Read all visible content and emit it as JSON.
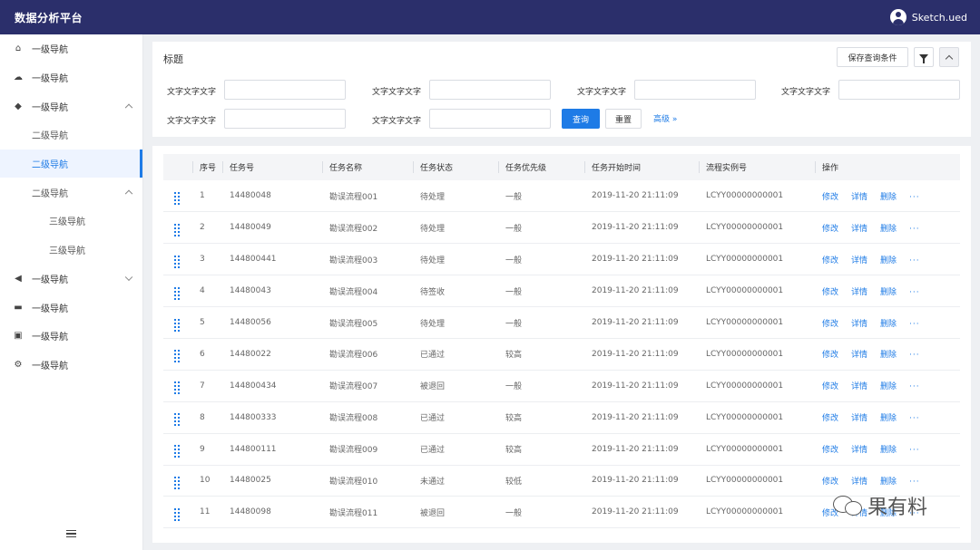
{
  "app": {
    "title": "数据分析平台",
    "user_name": "Sketch.ued"
  },
  "sidebar": {
    "items": [
      {
        "label": "一级导航",
        "icon": "home-icon",
        "level": 1
      },
      {
        "label": "一级导航",
        "icon": "cloud-icon",
        "level": 1
      },
      {
        "label": "一级导航",
        "icon": "tag-icon",
        "level": 1,
        "expanded": true
      },
      {
        "label": "二级导航",
        "level": 2
      },
      {
        "label": "二级导航",
        "level": 2,
        "active": true
      },
      {
        "label": "二级导航",
        "level": 2,
        "expanded": true
      },
      {
        "label": "三级导航",
        "level": 3
      },
      {
        "label": "三级导航",
        "level": 3
      },
      {
        "label": "一级导航",
        "icon": "speaker-icon",
        "level": 1,
        "expanded": false
      },
      {
        "label": "一级导航",
        "icon": "card-icon",
        "level": 1
      },
      {
        "label": "一级导航",
        "icon": "image-icon",
        "level": 1
      },
      {
        "label": "一级导航",
        "icon": "settings-icon",
        "level": 1
      }
    ]
  },
  "filter": {
    "title": "标题",
    "save_label": "保存查询条件",
    "field_label": "文字文字文字",
    "query_label": "查询",
    "reset_label": "重置",
    "advanced_label": "高级"
  },
  "table": {
    "columns": [
      "序号",
      "任务号",
      "任务名称",
      "任务状态",
      "任务优先级",
      "任务开始时间",
      "流程实例号",
      "操作"
    ],
    "actions": [
      "修改",
      "详情",
      "删除",
      "···"
    ],
    "rows": [
      [
        "1",
        "14480048",
        "勘误流程001",
        "待处理",
        "一般",
        "2019-11-20  21:11:09",
        "LCYY00000000001"
      ],
      [
        "2",
        "14480049",
        "勘误流程002",
        "待处理",
        "一般",
        "2019-11-20  21:11:09",
        "LCYY00000000001"
      ],
      [
        "3",
        "144800441",
        "勘误流程003",
        "待处理",
        "一般",
        "2019-11-20  21:11:09",
        "LCYY00000000001"
      ],
      [
        "4",
        "14480043",
        "勘误流程004",
        "待签收",
        "一般",
        "2019-11-20  21:11:09",
        "LCYY00000000001"
      ],
      [
        "5",
        "14480056",
        "勘误流程005",
        "待处理",
        "一般",
        "2019-11-20  21:11:09",
        "LCYY00000000001"
      ],
      [
        "6",
        "14480022",
        "勘误流程006",
        "已通过",
        "较高",
        "2019-11-20  21:11:09",
        "LCYY00000000001"
      ],
      [
        "7",
        "144800434",
        "勘误流程007",
        "被退回",
        "一般",
        "2019-11-20  21:11:09",
        "LCYY00000000001"
      ],
      [
        "8",
        "144800333",
        "勘误流程008",
        "已通过",
        "较高",
        "2019-11-20  21:11:09",
        "LCYY00000000001"
      ],
      [
        "9",
        "144800111",
        "勘误流程009",
        "已通过",
        "较高",
        "2019-11-20  21:11:09",
        "LCYY00000000001"
      ],
      [
        "10",
        "14480025",
        "勘误流程010",
        "未通过",
        "较低",
        "2019-11-20  21:11:09",
        "LCYY00000000001"
      ],
      [
        "11",
        "14480098",
        "勘误流程011",
        "被退回",
        "一般",
        "2019-11-20  21:11:09",
        "LCYY00000000001"
      ]
    ]
  },
  "watermark": {
    "text": "果有料"
  },
  "colors": {
    "header": "#2b2f6b",
    "accent": "#1e7be6"
  }
}
